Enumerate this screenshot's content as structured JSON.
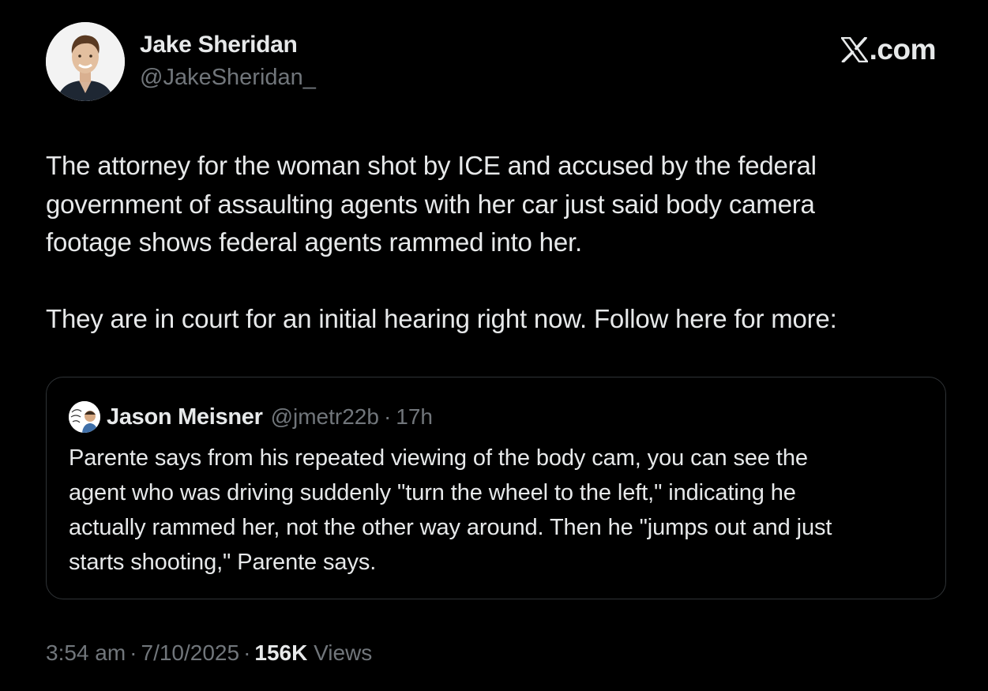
{
  "author": {
    "name": "Jake Sheridan",
    "handle": "@JakeSheridan_"
  },
  "brand": {
    "logo_icon": "x-logo-icon",
    "suffix": ".com"
  },
  "tweet": {
    "paragraphs": [
      "The attorney for the woman shot by ICE and accused by the federal\ngovernment of assaulting agents with her car just said body camera\nfootage shows federal agents rammed into her.",
      "They are in court for an initial hearing right now. Follow here for more:"
    ]
  },
  "quote": {
    "author_name": "Jason Meisner",
    "author_handle": "@jmetr22b",
    "separator": "·",
    "time": "17h",
    "text": "Parente says from his repeated viewing of the body cam, you can see the\nagent who was driving suddenly \"turn the wheel to the left,\" indicating he\nactually rammed her, not the other way around. Then he \"jumps out and just\nstarts shooting,\" Parente says."
  },
  "meta": {
    "time": "3:54 am",
    "date": "7/10/2025",
    "separator": "·",
    "views_count": "156K",
    "views_label": "Views"
  },
  "colors": {
    "background": "#000000",
    "text_primary": "#e7e9ea",
    "text_secondary": "#71767b",
    "border": "#2f3336"
  }
}
